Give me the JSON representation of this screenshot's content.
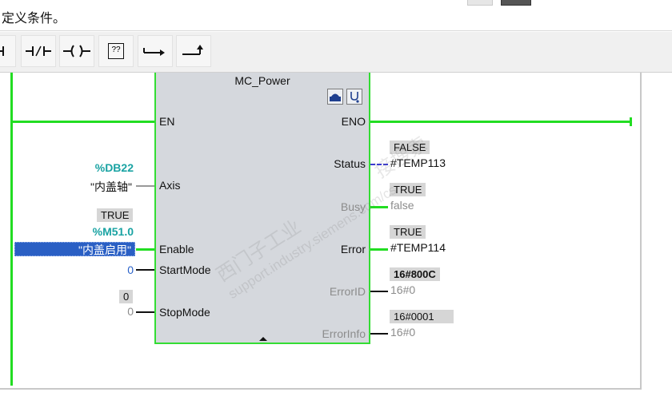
{
  "header": {
    "title": "定义条件。"
  },
  "toolbar": {
    "buttons": [
      {
        "name": "contact-no-button",
        "icon": "no-contact-icon"
      },
      {
        "name": "contact-nc-button",
        "icon": "nc-contact-icon"
      },
      {
        "name": "coil-button",
        "icon": "coil-icon"
      },
      {
        "name": "empty-box-button",
        "icon": "empty-box-icon",
        "label": "??"
      },
      {
        "name": "open-branch-button",
        "icon": "open-branch-icon"
      },
      {
        "name": "close-branch-button",
        "icon": "close-branch-icon"
      }
    ]
  },
  "block": {
    "name": "MC_Power",
    "inputs": {
      "en": "EN",
      "axis": "Axis",
      "enable": "Enable",
      "start_mode": "StartMode",
      "stop_mode": "StopMode"
    },
    "outputs": {
      "eno": "ENO",
      "status": "Status",
      "busy": "Busy",
      "error": "Error",
      "error_id": "ErrorID",
      "error_info": "ErrorInfo"
    }
  },
  "operands": {
    "axis": {
      "address": "%DB22",
      "symbol": "\"内盖轴\""
    },
    "enable": {
      "monitor": "TRUE",
      "address": "%M51.0",
      "symbol": "\"内盖启用\""
    },
    "start_mode": {
      "value": "0"
    },
    "stop_mode": {
      "monitor": "0",
      "value": "0"
    },
    "status": {
      "monitor": "FALSE",
      "target": "#TEMP113"
    },
    "busy": {
      "monitor": "TRUE",
      "target": "false"
    },
    "error": {
      "monitor": "TRUE",
      "target": "#TEMP114"
    },
    "error_id": {
      "monitor": "16#800C",
      "target": "16#0"
    },
    "error_info": {
      "monitor": "16#0001",
      "target": "16#0"
    }
  },
  "watermark": {
    "text": "西门子工业",
    "url": "support.industry.siemens.com/cs",
    "extra": "接搜索"
  },
  "colors": {
    "power_flow": "#22dd22",
    "selection": "#2a5fc4",
    "teal": "#1aa3a3",
    "block_bg": "#d5d8dd"
  }
}
